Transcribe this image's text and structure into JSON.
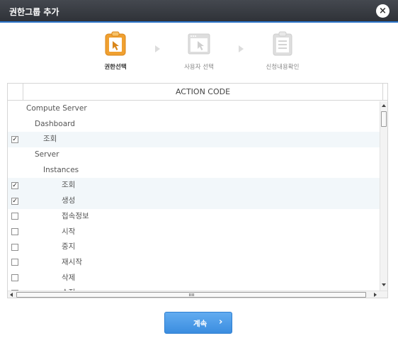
{
  "dialog": {
    "title": "권한그룹 추가",
    "close_icon": "×"
  },
  "steps": [
    {
      "label": "권한선택",
      "icon": "clipboard-cursor-icon",
      "active": true
    },
    {
      "label": "사용자 선택",
      "icon": "window-cursor-icon",
      "active": false
    },
    {
      "label": "신청내용확인",
      "icon": "clipboard-list-icon",
      "active": false
    }
  ],
  "grid": {
    "header": "ACTION CODE",
    "rows": [
      {
        "text": "Compute Server",
        "level": 0,
        "has_checkbox": false,
        "checked": false
      },
      {
        "text": "Dashboard",
        "level": 1,
        "has_checkbox": false,
        "checked": false
      },
      {
        "text": "조회",
        "level": 2,
        "has_checkbox": true,
        "checked": true
      },
      {
        "text": "Server",
        "level": 1,
        "has_checkbox": false,
        "checked": false
      },
      {
        "text": "Instances",
        "level": 2,
        "has_checkbox": false,
        "checked": false
      },
      {
        "text": "조회",
        "level": 3,
        "has_checkbox": true,
        "checked": true
      },
      {
        "text": "생성",
        "level": 3,
        "has_checkbox": true,
        "checked": true
      },
      {
        "text": "접속정보",
        "level": 3,
        "has_checkbox": true,
        "checked": false
      },
      {
        "text": "시작",
        "level": 3,
        "has_checkbox": true,
        "checked": false
      },
      {
        "text": "중지",
        "level": 3,
        "has_checkbox": true,
        "checked": false
      },
      {
        "text": "재시작",
        "level": 3,
        "has_checkbox": true,
        "checked": false
      },
      {
        "text": "삭제",
        "level": 3,
        "has_checkbox": true,
        "checked": false
      },
      {
        "text": "수정",
        "level": 3,
        "has_checkbox": true,
        "checked": false
      }
    ]
  },
  "footer": {
    "continue_label": "계속",
    "continue_icon": "›"
  },
  "colors": {
    "accent": "#3b8de0",
    "active_step": "#f0a030",
    "title_bar": "#3a3d43"
  }
}
